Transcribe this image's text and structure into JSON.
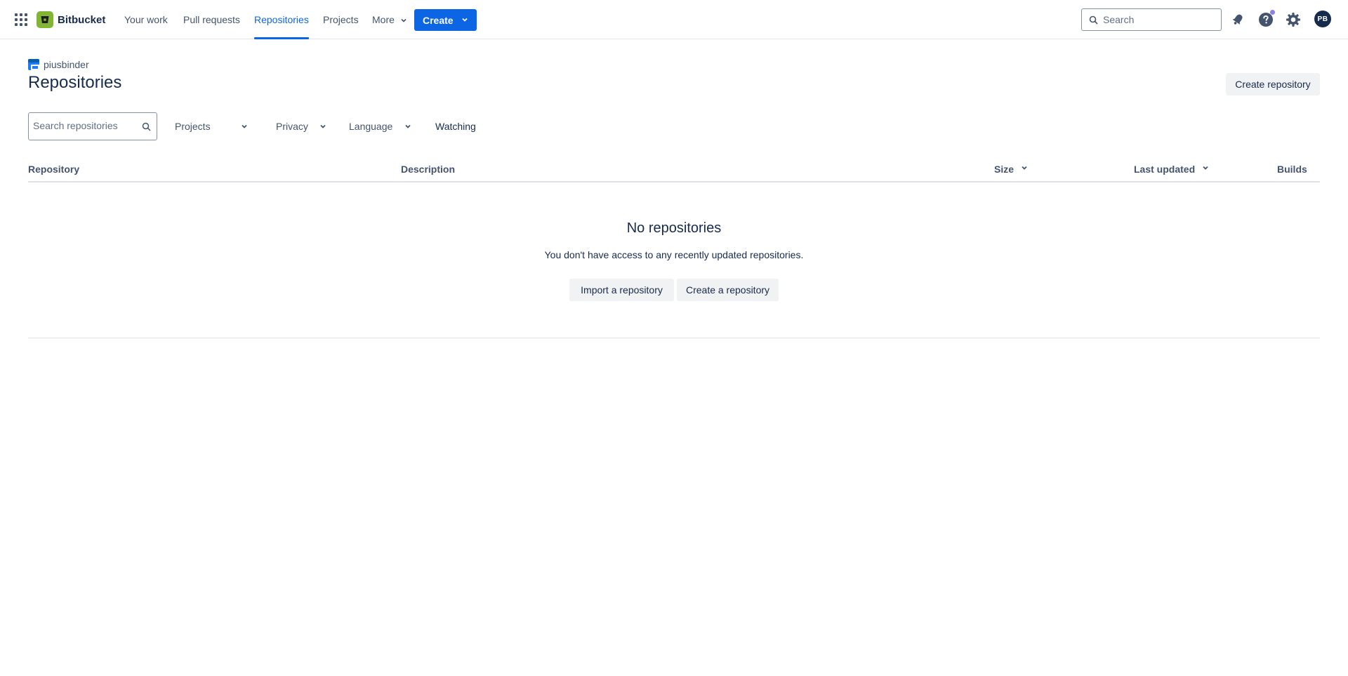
{
  "nav": {
    "brand": "Bitbucket",
    "items": [
      {
        "label": "Your work",
        "active": false
      },
      {
        "label": "Pull requests",
        "active": false
      },
      {
        "label": "Repositories",
        "active": true
      },
      {
        "label": "Projects",
        "active": false
      },
      {
        "label": "More",
        "active": false
      }
    ],
    "create_label": "Create",
    "search_placeholder": "Search",
    "avatar_initials": "PB"
  },
  "header": {
    "workspace": "piusbinder",
    "title": "Repositories",
    "create_repo_label": "Create repository"
  },
  "filters": {
    "search_placeholder": "Search repositories",
    "projects": "Projects",
    "privacy": "Privacy",
    "language": "Language",
    "watching": "Watching"
  },
  "table": {
    "columns": [
      "Repository",
      "Description",
      "Size",
      "Last updated",
      "Builds"
    ]
  },
  "empty": {
    "title": "No repositories",
    "message": "You don't have access to any recently updated repositories.",
    "import_label": "Import a repository",
    "create_label": "Create a repository"
  },
  "colors": {
    "accent": "#0c66e4",
    "brand": "#82b536",
    "text": "#172b4d",
    "subtle": "#44546f"
  }
}
